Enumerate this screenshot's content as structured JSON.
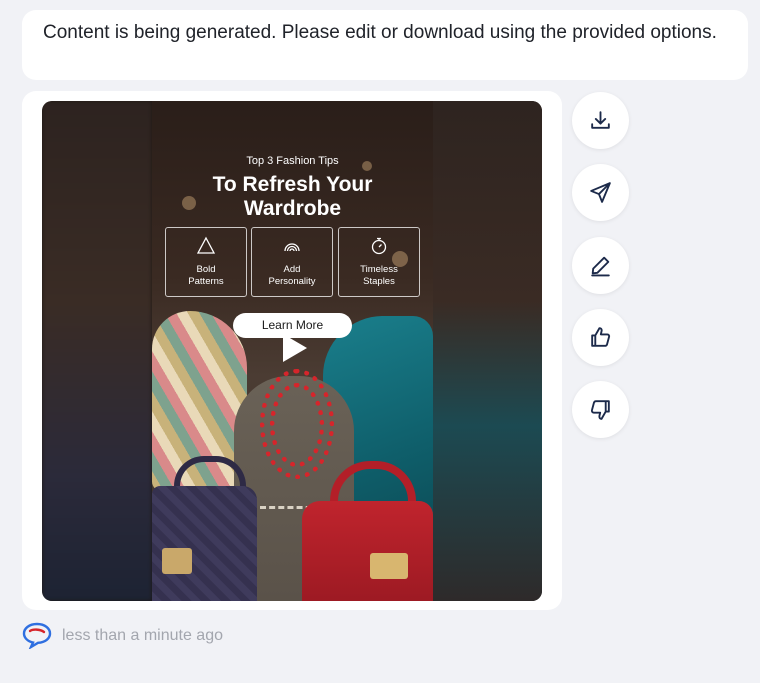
{
  "message": {
    "text": "Content is being generated. Please edit or download using the provided options."
  },
  "video": {
    "subtitle": "Top 3 Fashion Tips",
    "title_line1": "To Refresh Your",
    "title_line2": "Wardrobe",
    "tips": [
      {
        "icon": "triangle-icon",
        "line1": "Bold",
        "line2": "Patterns"
      },
      {
        "icon": "rainbow-icon",
        "line1": "Add",
        "line2": "Personality"
      },
      {
        "icon": "stopwatch-icon",
        "line1": "Timeless",
        "line2": "Staples"
      }
    ],
    "cta_label": "Learn More"
  },
  "actions": [
    {
      "name": "download",
      "icon": "download-icon"
    },
    {
      "name": "send",
      "icon": "send-icon"
    },
    {
      "name": "edit",
      "icon": "pencil-icon"
    },
    {
      "name": "like",
      "icon": "thumbs-up-icon"
    },
    {
      "name": "dislike",
      "icon": "thumbs-down-icon"
    }
  ],
  "footer": {
    "timestamp": "less than a minute ago"
  },
  "colors": {
    "background": "#f1f2f6",
    "card": "#ffffff",
    "icon": "#1c2a4a",
    "muted_text": "#a3a6ae",
    "accent_red": "#d6252b",
    "accent_blue": "#2f6fe0"
  }
}
